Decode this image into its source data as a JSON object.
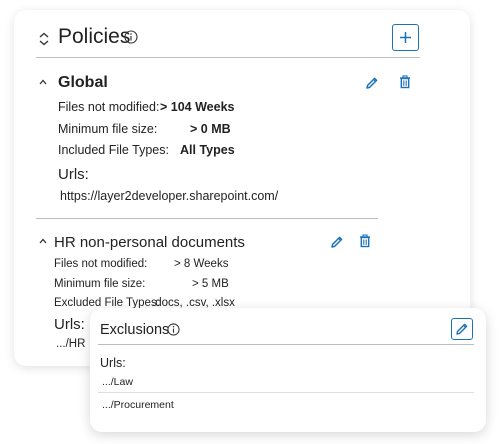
{
  "header": {
    "title": "Policies"
  },
  "global": {
    "title": "Global",
    "rows": [
      {
        "label": "Files not modified:",
        "value": "> 104 Weeks"
      },
      {
        "label": "Minimum file size:",
        "value": "> 0 MB"
      },
      {
        "label": "Included File Types:",
        "value": "All Types"
      }
    ],
    "urls_title": "Urls:",
    "url": "https://layer2developer.sharepoint.com/"
  },
  "hr": {
    "title": "HR non-personal documents",
    "rows": [
      {
        "label": "Files not modified:",
        "value": "> 8 Weeks"
      },
      {
        "label": "Minimum file size:",
        "value": "> 5 MB"
      },
      {
        "label": "Excluded File Types:",
        "value": ".docs, .csv, .xlsx"
      }
    ],
    "urls_title": "Urls:",
    "url": ".../HR"
  },
  "exclusions": {
    "title": "Exclusions",
    "urls_title": "Urls:",
    "items": [
      ".../Law",
      ".../Procurement"
    ]
  },
  "colors": {
    "accent": "#1a73b8",
    "divider": "#bdbdbd"
  },
  "icons": [
    "collapse-icon",
    "info-icon",
    "plus-icon",
    "chevron-up-icon",
    "pencil-icon",
    "trash-icon"
  ]
}
